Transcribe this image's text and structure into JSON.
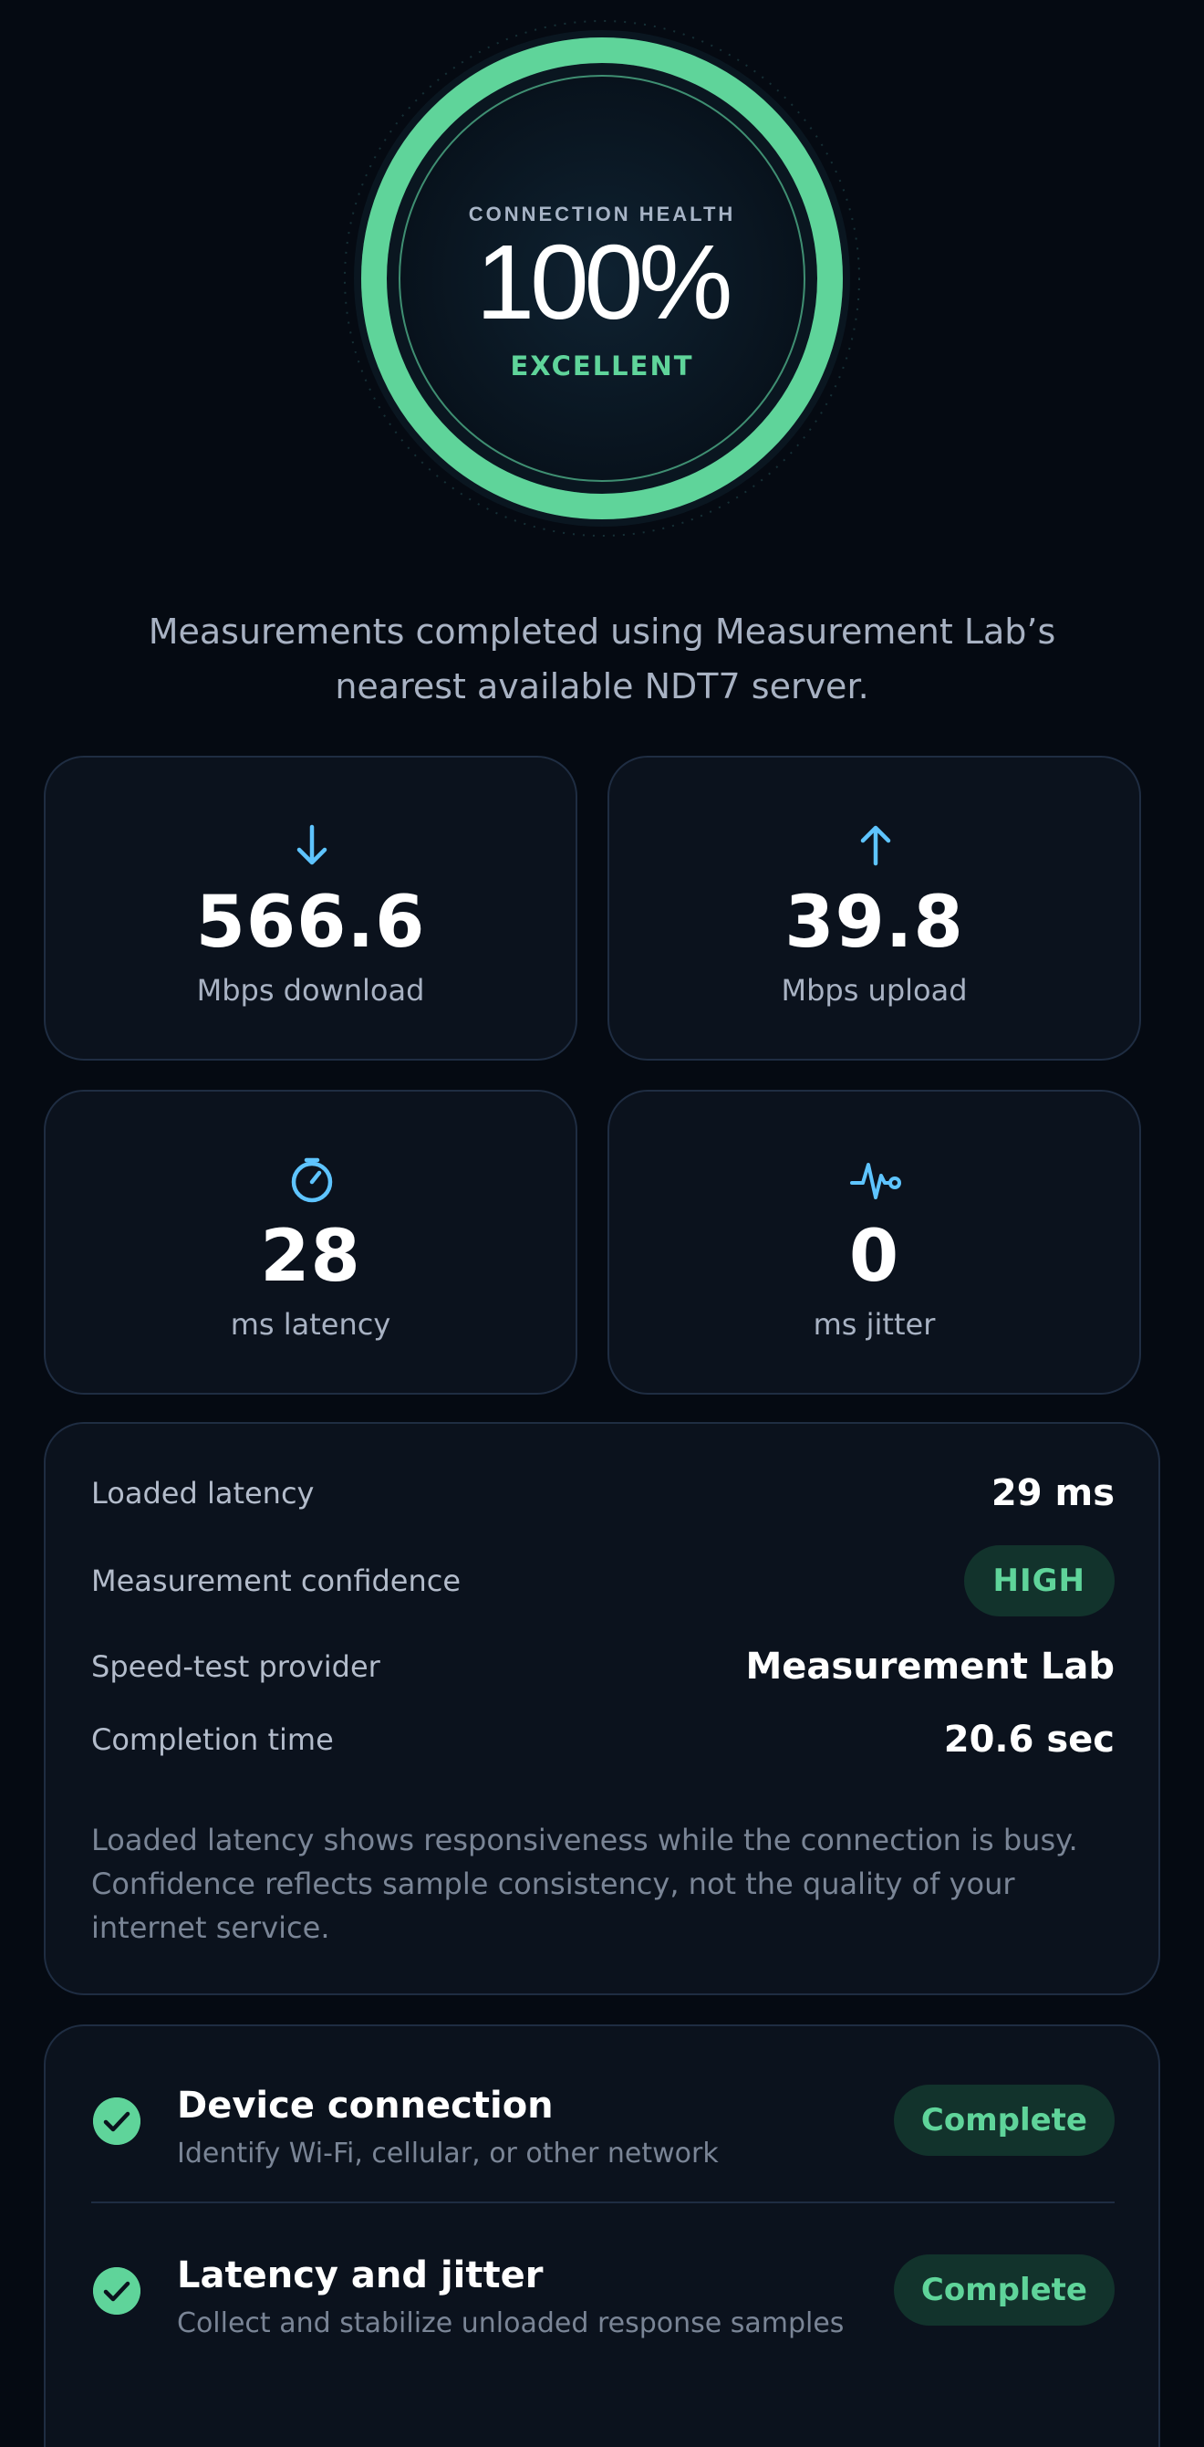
{
  "gauge": {
    "label": "CONNECTION HEALTH",
    "value": "100%",
    "status": "EXCELLENT",
    "percent": 100
  },
  "intro": "Measurements completed using Measurement Lab’s nearest available NDT7 server.",
  "metrics": [
    {
      "icon": "arrow-down-icon",
      "value": "566.6",
      "label": "Mbps download"
    },
    {
      "icon": "arrow-up-icon",
      "value": "39.8",
      "label": "Mbps upload"
    },
    {
      "icon": "stopwatch-icon",
      "value": "28",
      "label": "ms latency"
    },
    {
      "icon": "pulse-icon",
      "value": "0",
      "label": "ms jitter"
    }
  ],
  "details": {
    "rows": [
      {
        "label": "Loaded latency",
        "value": "29 ms"
      },
      {
        "label": "Measurement confidence",
        "value": "HIGH"
      },
      {
        "label": "Speed-test provider",
        "value": "Measurement Lab"
      },
      {
        "label": "Completion time",
        "value": "20.6 sec"
      }
    ],
    "note": "Loaded latency shows responsiveness while the connection is busy. Confidence reflects sample consistency, not the quality of your internet service."
  },
  "steps": [
    {
      "title": "Device connection",
      "description": "Identify Wi-Fi, cellular, or other network",
      "status": "Complete"
    },
    {
      "title": "Latency and jitter",
      "description": "Collect and stabilize unloaded response samples",
      "status": "Complete"
    }
  ],
  "colors": {
    "background": "#050a12",
    "card": "#0b121d",
    "accent_green": "#5fd49a",
    "accent_blue": "#5ec4ff",
    "muted_text": "#a8b2c3"
  }
}
